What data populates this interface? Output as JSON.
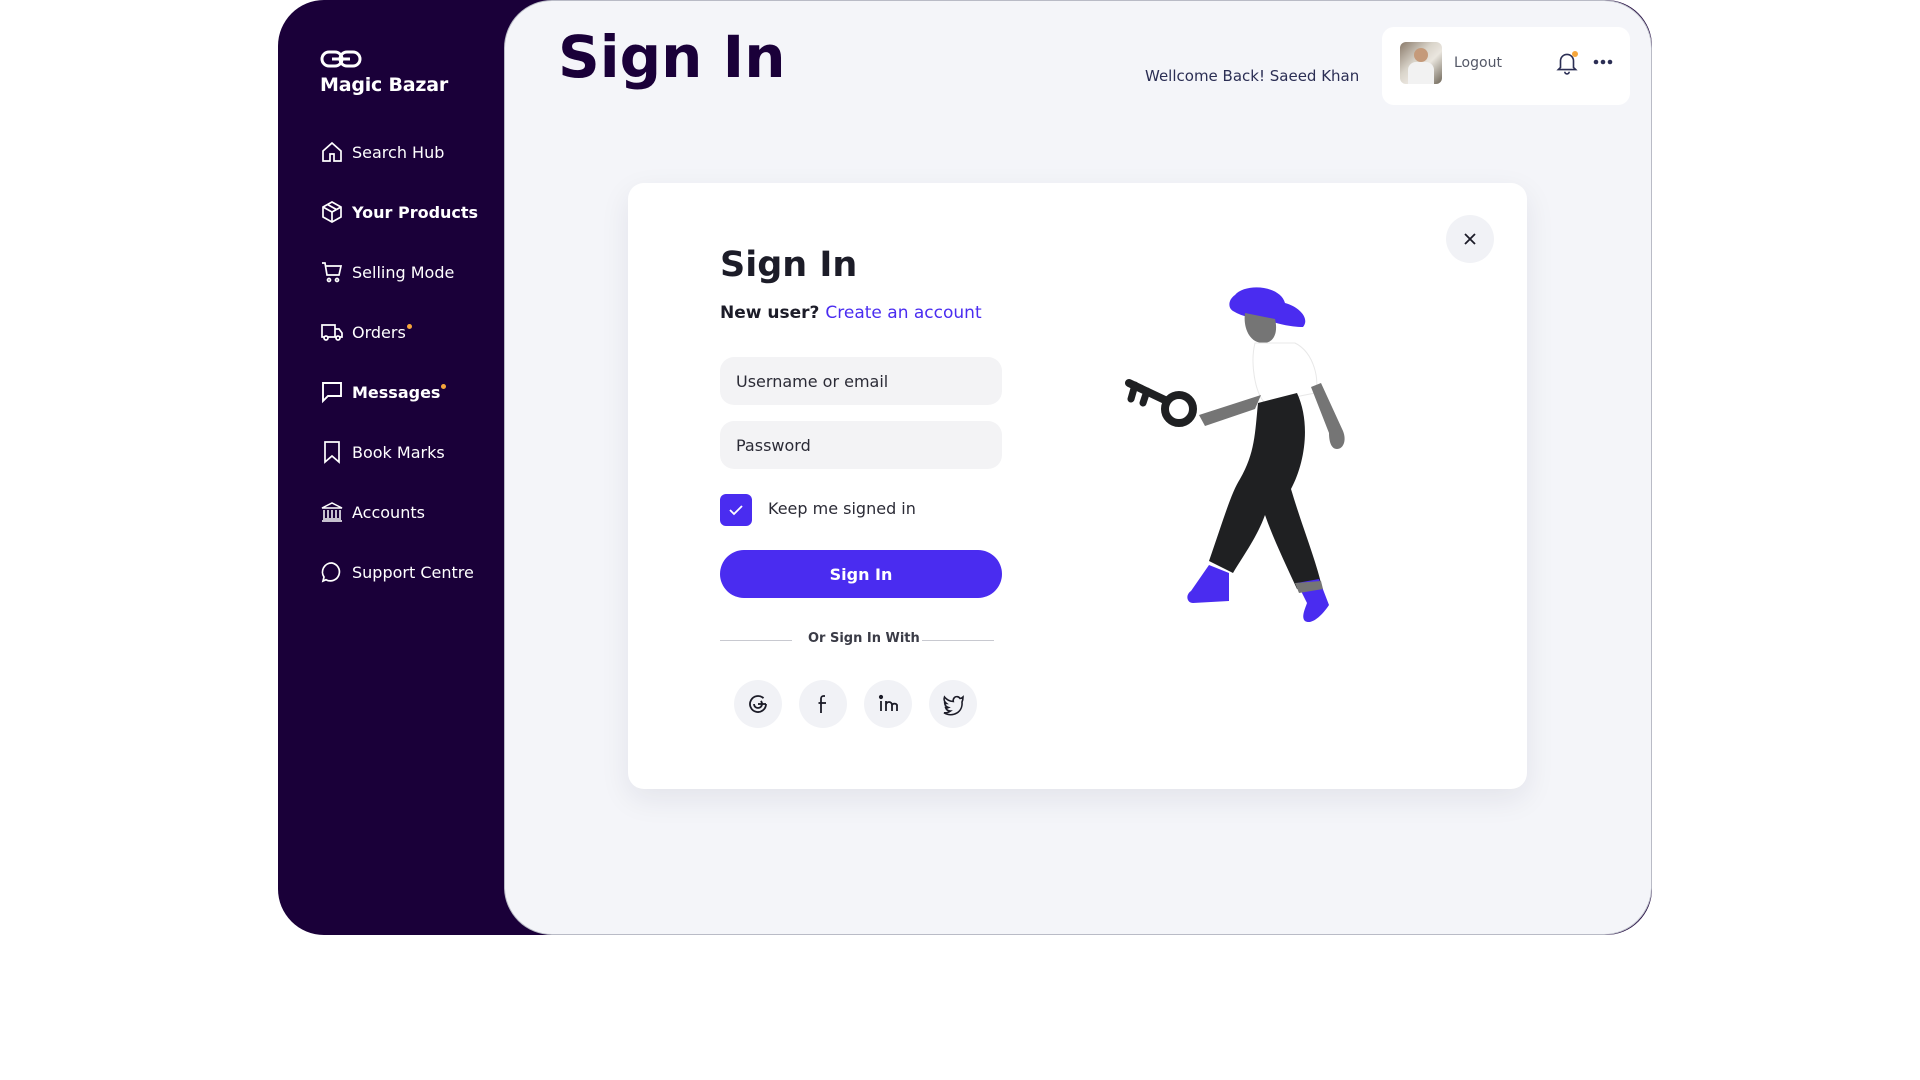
{
  "brand": {
    "name": "Magic Bazar"
  },
  "sidebar": {
    "items": [
      {
        "label": "Search Hub",
        "icon": "home-icon",
        "bold": false,
        "dot": false
      },
      {
        "label": "Your Products",
        "icon": "box-icon",
        "bold": true,
        "dot": false
      },
      {
        "label": "Selling Mode",
        "icon": "cart-icon",
        "bold": false,
        "dot": false
      },
      {
        "label": "Orders",
        "icon": "truck-icon",
        "bold": false,
        "dot": true
      },
      {
        "label": "Messages",
        "icon": "message-icon",
        "bold": true,
        "dot": true
      },
      {
        "label": "Book Marks",
        "icon": "bookmark-icon",
        "bold": false,
        "dot": false
      },
      {
        "label": "Accounts",
        "icon": "bank-icon",
        "bold": false,
        "dot": false
      },
      {
        "label": "Support Centre",
        "icon": "chat-bubble-icon",
        "bold": false,
        "dot": false
      }
    ]
  },
  "header": {
    "title": "Sign In",
    "welcome": "Wellcome Back!  Saeed Khan",
    "logout": "Logout"
  },
  "dialog": {
    "title": "Sign In",
    "new_user": "New user?",
    "create_account": "Create an account",
    "username_placeholder": "Username or email",
    "password_placeholder": "Password",
    "keep_signed_in": "Keep me signed in",
    "keep_checked": true,
    "sign_in_button": "Sign In",
    "or_sign_in_with": "Or Sign In With",
    "social": [
      "google-icon",
      "facebook-icon",
      "linkedin-icon",
      "twitter-icon"
    ]
  },
  "colors": {
    "sidebar_bg": "#1a0039",
    "accent": "#4a2cf0",
    "notification_dot": "#f6a63b",
    "page_bg": "#f4f5f9"
  }
}
